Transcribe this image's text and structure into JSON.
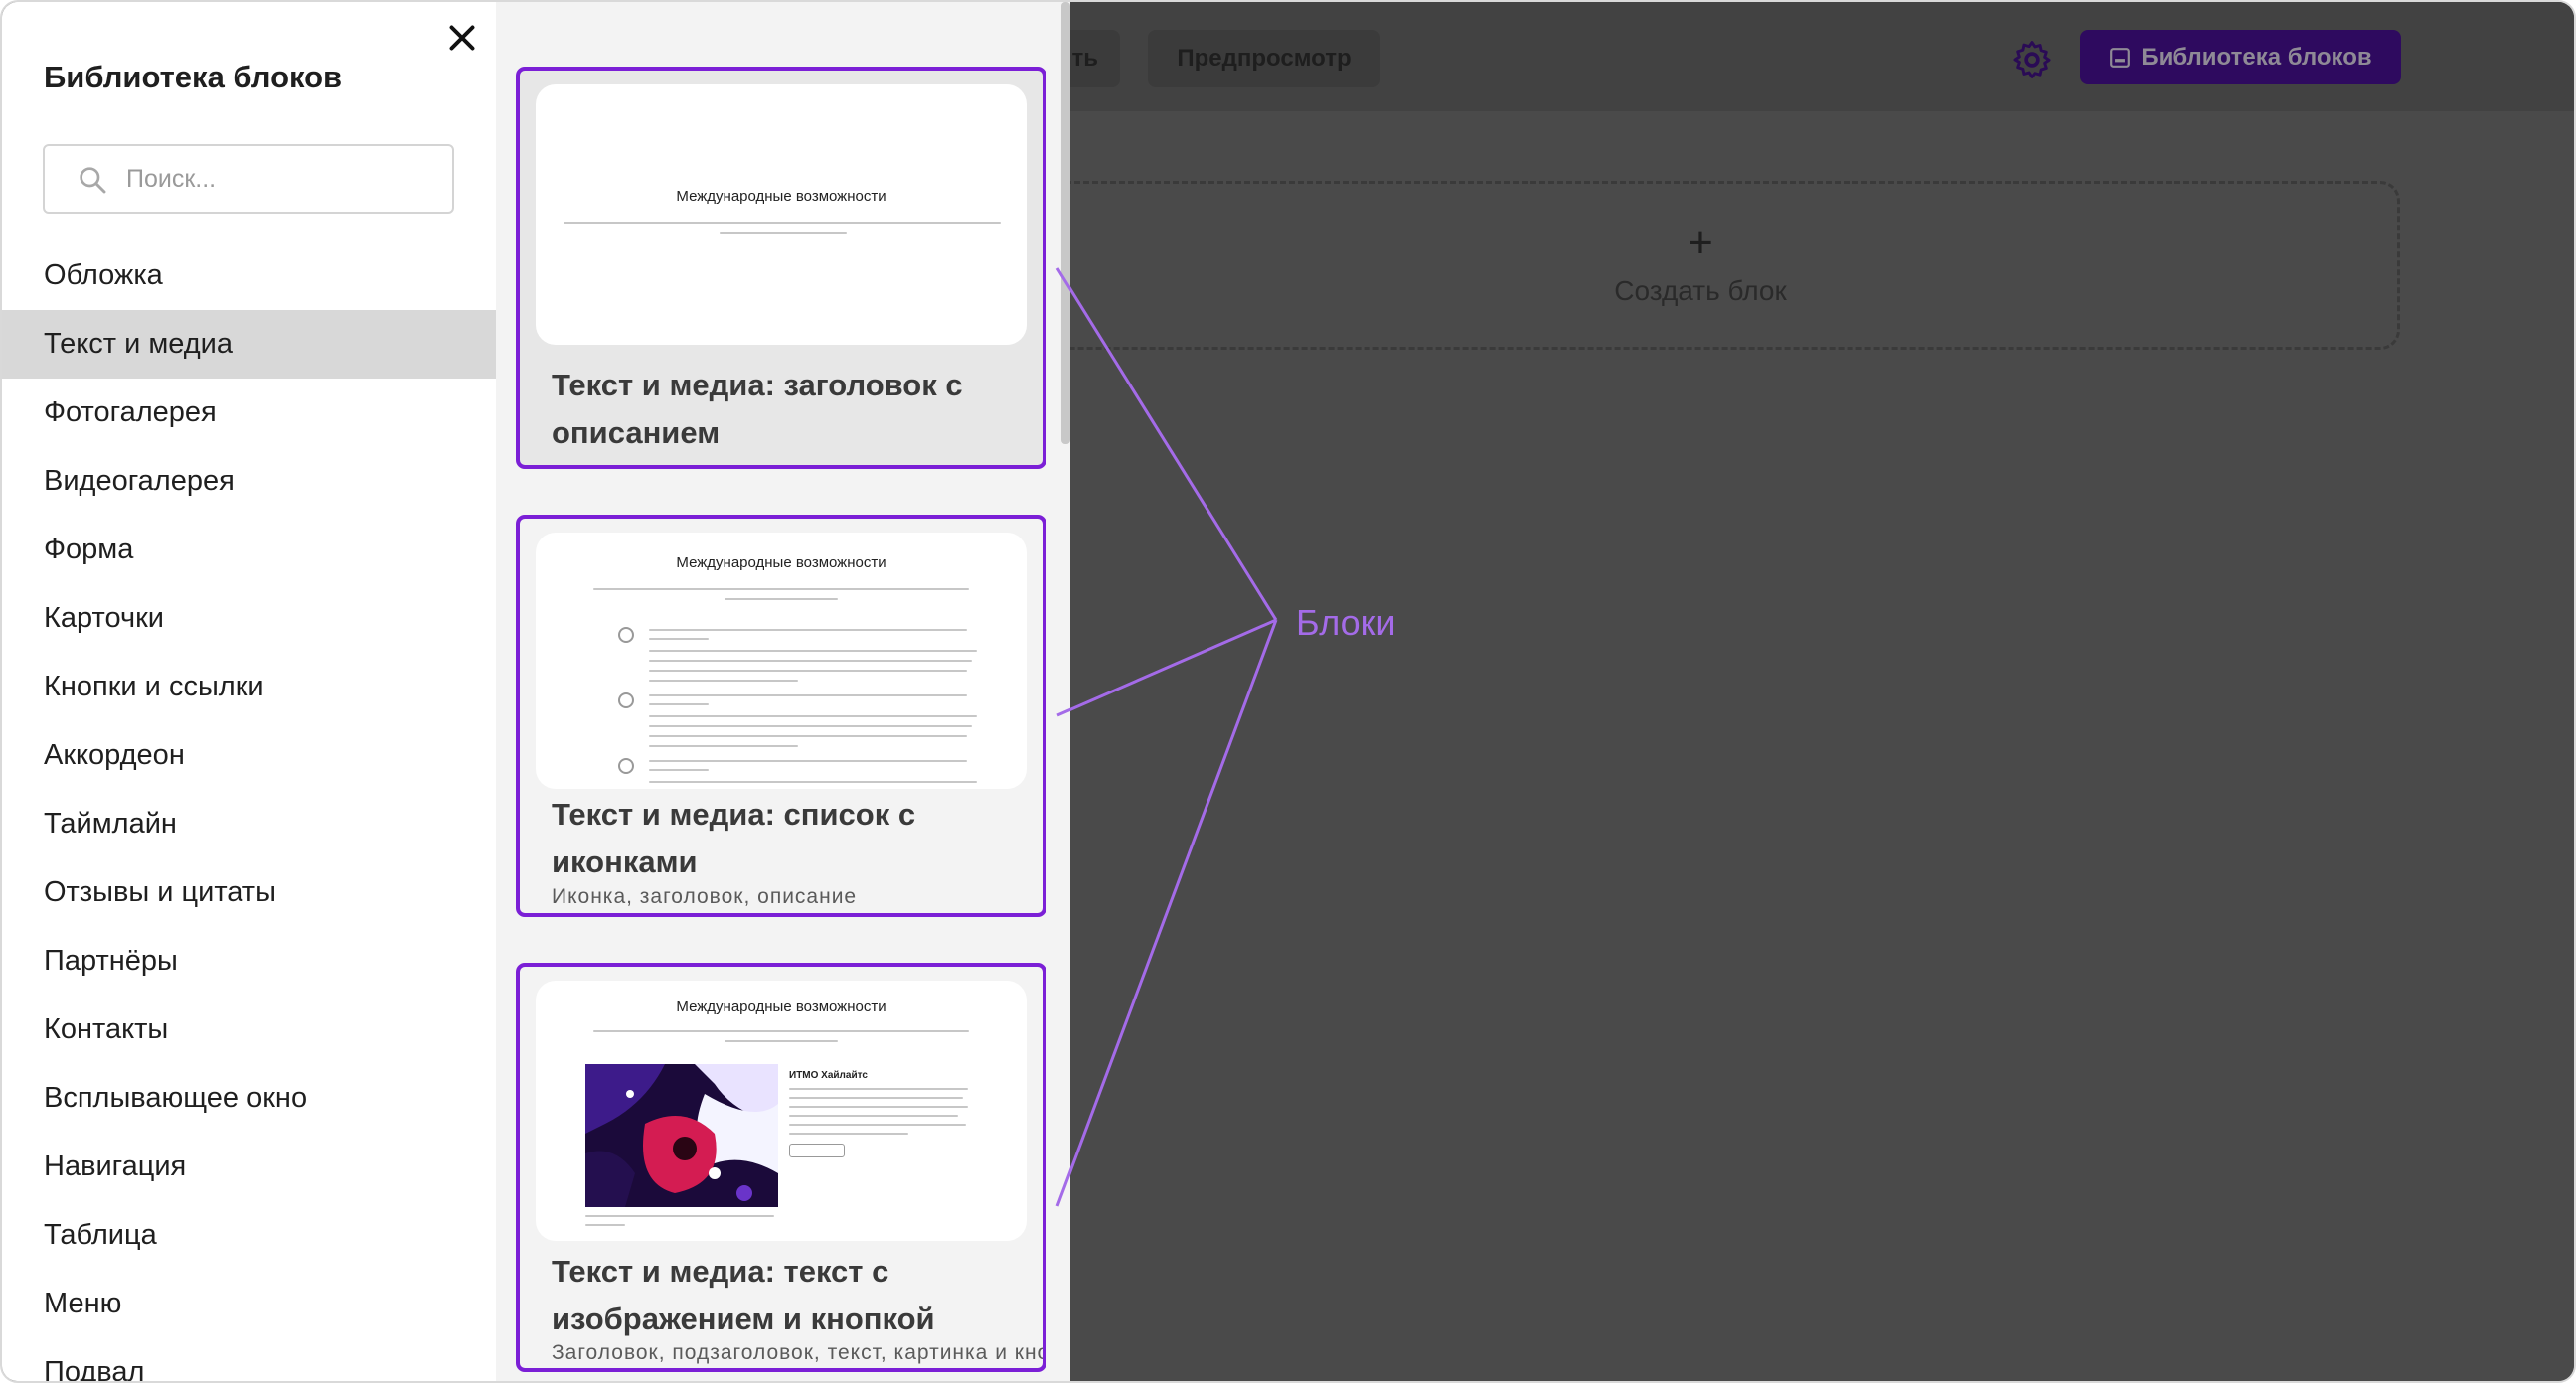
{
  "editor": {
    "save_label": "ть",
    "preview_label": "Предпросмотр",
    "library_button_label": "Библиотека блоков",
    "create_block_plus": "+",
    "create_block_label": "Создать блок"
  },
  "panel": {
    "title": "Библиотека блоков",
    "search_placeholder": "Поиск...",
    "categories": [
      "Обложка",
      "Текст и медиа",
      "Фотогалерея",
      "Видеогалерея",
      "Форма",
      "Карточки",
      "Кнопки и ссылки",
      "Аккордеон",
      "Таймлайн",
      "Отзывы и цитаты",
      "Партнёры",
      "Контакты",
      "Всплывающее окно",
      "Навигация",
      "Таблица",
      "Меню",
      "Подвал"
    ],
    "active_category": "Текст и медиа"
  },
  "cards": [
    {
      "thumb_title": "Международные возможности",
      "title": "Текст и медиа: заголовок с описанием",
      "description": ""
    },
    {
      "thumb_title": "Международные возможности",
      "title": "Текст и медиа: список с иконками",
      "description": "Иконка, заголовок, описание"
    },
    {
      "thumb_title": "Международные возможности",
      "thumb_subtitle": "ИТМО Хайлайтс",
      "title": "Текст и медиа: текст с изображением и кнопкой",
      "description": "Заголовок, подзаголовок, текст, картинка и кнопка"
    }
  ],
  "annotation": {
    "label": "Блоки"
  },
  "colors": {
    "accent": "#7b1fd6",
    "annotation": "#a46be8",
    "overlay": "#4a4a4a"
  }
}
